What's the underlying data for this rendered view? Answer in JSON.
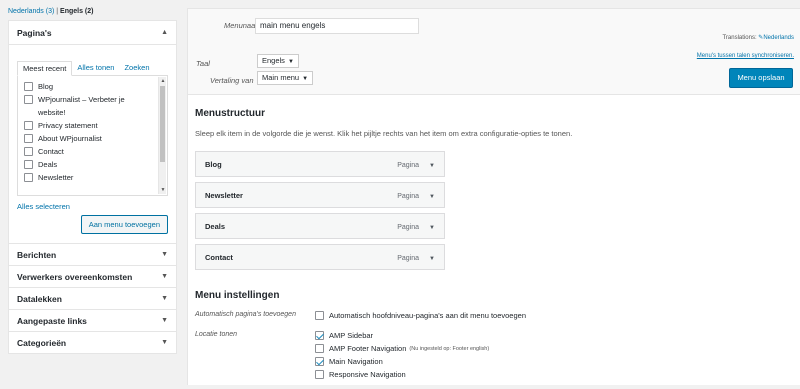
{
  "lang_filter": {
    "nl": "Nederlands (3)",
    "sep": " | ",
    "en": "Engels (2)"
  },
  "pages_panel": {
    "title": "Pagina's",
    "tabs": [
      "Meest recent",
      "Alles tonen",
      "Zoeken"
    ],
    "items": [
      "Blog",
      "WPjournalist – Verbeter je website!",
      "Privacy statement",
      "About WPjournalist",
      "Contact",
      "Deals",
      "Newsletter"
    ],
    "select_all": "Alles selecteren",
    "add_button": "Aan menu toevoegen"
  },
  "collapsed_panels": [
    "Berichten",
    "Verwerkers overeenkomsten",
    "Datalekken",
    "Aangepaste links",
    "Categorieën"
  ],
  "header": {
    "menu_name_label": "Menunaam",
    "menu_name_value": "main menu engels",
    "language_label": "Taal",
    "language_value": "Engels",
    "translation_label": "Vertaling van",
    "translation_value": "Main menu",
    "translations_prefix": "Translations:",
    "translations_link": "Nederlands",
    "sync_link": "Menu's tussen talen synchroniseren.",
    "save_button": "Menu opslaan"
  },
  "structure": {
    "title": "Menustructuur",
    "description": "Sleep elk item in de volgorde die je wenst. Klik het pijltje rechts van het item om extra configuratie-opties te tonen.",
    "items": [
      {
        "title": "Blog",
        "type": "Pagina"
      },
      {
        "title": "Newsletter",
        "type": "Pagina"
      },
      {
        "title": "Deals",
        "type": "Pagina"
      },
      {
        "title": "Contact",
        "type": "Pagina"
      }
    ]
  },
  "settings": {
    "title": "Menu instellingen",
    "auto_add_label": "Automatisch pagina's toevoegen",
    "auto_add_text": "Automatisch hoofdniveau-pagina's aan dit menu toevoegen",
    "location_label": "Locatie tonen",
    "locations": [
      {
        "name": "AMP Sidebar",
        "checked": true,
        "note": ""
      },
      {
        "name": "AMP Footer Navigation",
        "checked": false,
        "note": "(Nu ingesteld op: Footer english)"
      },
      {
        "name": "Main Navigation",
        "checked": true,
        "note": ""
      },
      {
        "name": "Responsive Navigation",
        "checked": false,
        "note": ""
      }
    ]
  }
}
